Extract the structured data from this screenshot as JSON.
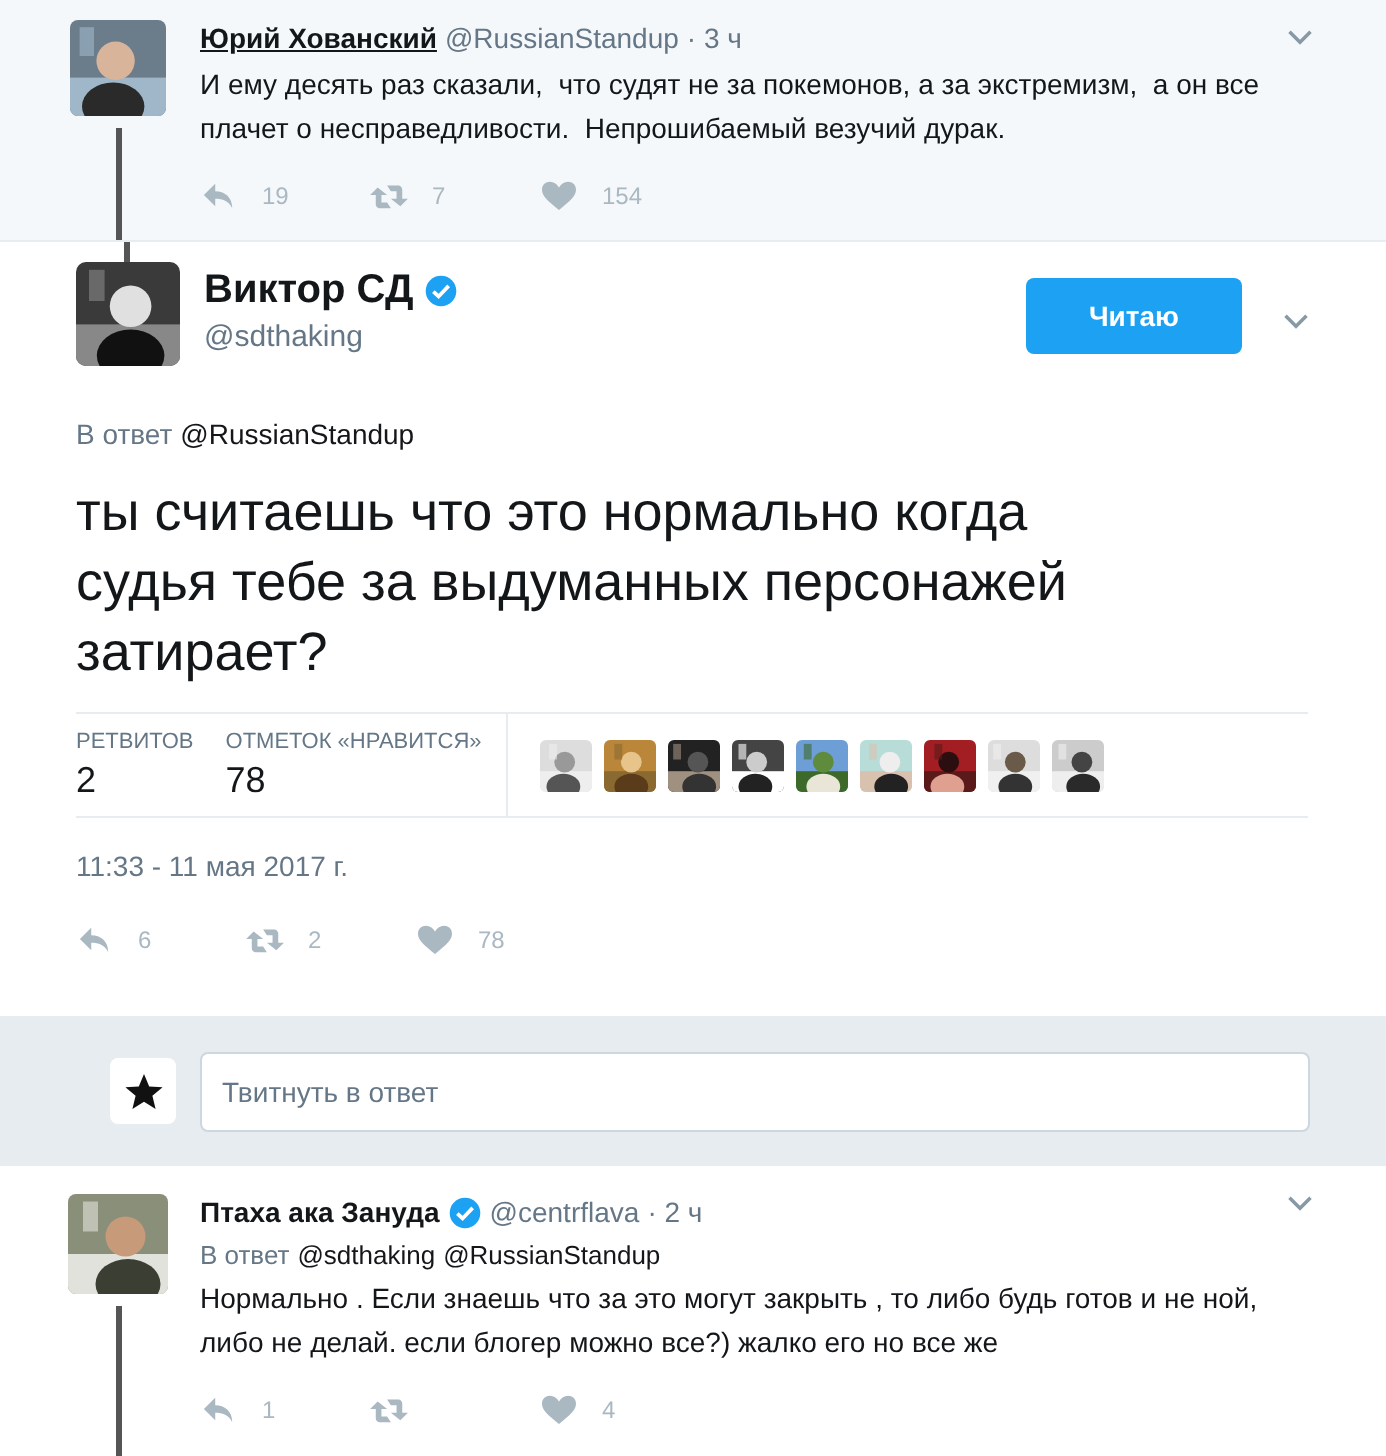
{
  "parent_tweet": {
    "name": "Юрий Хованский",
    "handle": "@RussianStandup",
    "time": "· 3 ч",
    "text": "И ему десять раз сказали,  что судят не за покемонов, а за экстремизм,  а он все плачет о несправедливости.  Непрошибаемый везучий дурак.",
    "verified": false,
    "actions": {
      "replies": "19",
      "retweets": "7",
      "likes": "154"
    }
  },
  "main_tweet": {
    "name": "Виктор СД",
    "verified": true,
    "handle": "@sdthaking",
    "follow_button": "Читаю",
    "reply_label": "В ответ",
    "reply_to": [
      "@RussianStandup"
    ],
    "text": "ты считаешь что это нормально когда судья тебе за выдуманных персонажей затирает?",
    "stats": [
      {
        "label": "РЕТВИТОВ",
        "value": "2"
      },
      {
        "label": "ОТМЕТОК «НРАВИТСЯ»",
        "value": "78"
      }
    ],
    "timestamp": "11:33 - 11 мая 2017 г.",
    "actions": {
      "replies": "6",
      "retweets": "2",
      "likes": "78"
    }
  },
  "reply_box": {
    "placeholder": "Твитнуть в ответ"
  },
  "reply_tweet": {
    "name": "Птаха ака Зануда",
    "verified": true,
    "handle": "@centrflava",
    "time": "· 2 ч",
    "reply_label": "В ответ",
    "reply_to": [
      "@sdthaking",
      "@RussianStandup"
    ],
    "text": "Нормально . Если знаешь что за это могут закрыть , то либо будь готов и не ной, либо не делай. если блогер можно все?) жалко его но все же",
    "actions": {
      "replies": "1",
      "likes": "4"
    }
  }
}
